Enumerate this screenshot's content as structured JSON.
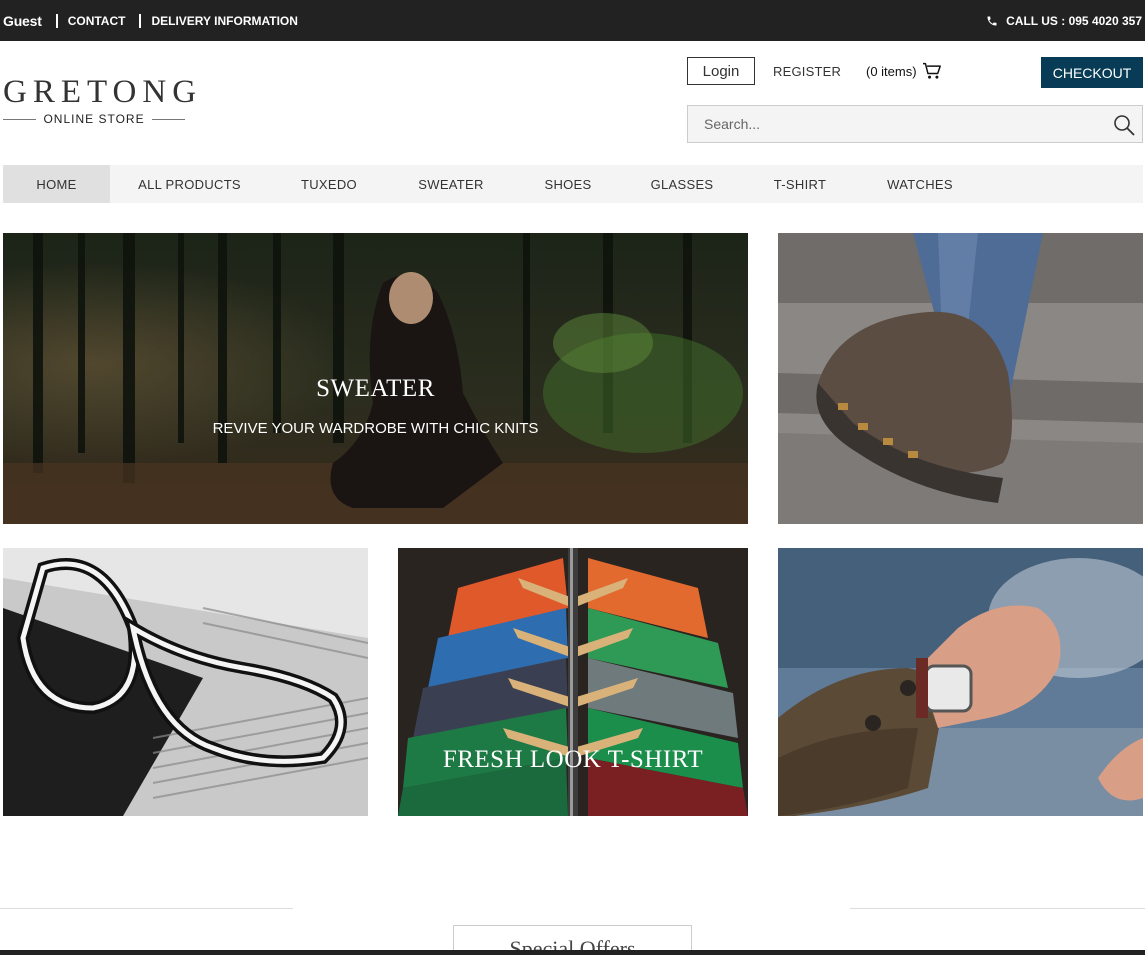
{
  "topbar": {
    "guest": "Guest",
    "links": [
      "CONTACT",
      "DELIVERY INFORMATION"
    ],
    "phone": "CALL US : 095 4020 357"
  },
  "logo": {
    "name": "GRETONG",
    "tagline": "ONLINE STORE"
  },
  "header": {
    "login": "Login",
    "register": "REGISTER",
    "cart": "(0 items)",
    "checkout": "CHECKOUT",
    "search_placeholder": "Search..."
  },
  "nav": {
    "items": [
      "HOME",
      "ALL PRODUCTS",
      "TUXEDO",
      "SWEATER",
      "SHOES",
      "GLASSES",
      "T-SHIRT",
      "WATCHES"
    ],
    "active": "HOME"
  },
  "banners": {
    "sweater": {
      "title": "SWEATER",
      "subtitle": "REVIVE YOUR WARDROBE WITH CHIC KNITS"
    },
    "tshirt": {
      "title": "FRESH LOOK T-SHIRT"
    }
  },
  "section": {
    "title": "Special Offers"
  },
  "colors": {
    "topbar": "#222222",
    "checkout": "#083b55",
    "nav_bg": "#f4f4f4",
    "nav_active": "#e0e0e0"
  }
}
